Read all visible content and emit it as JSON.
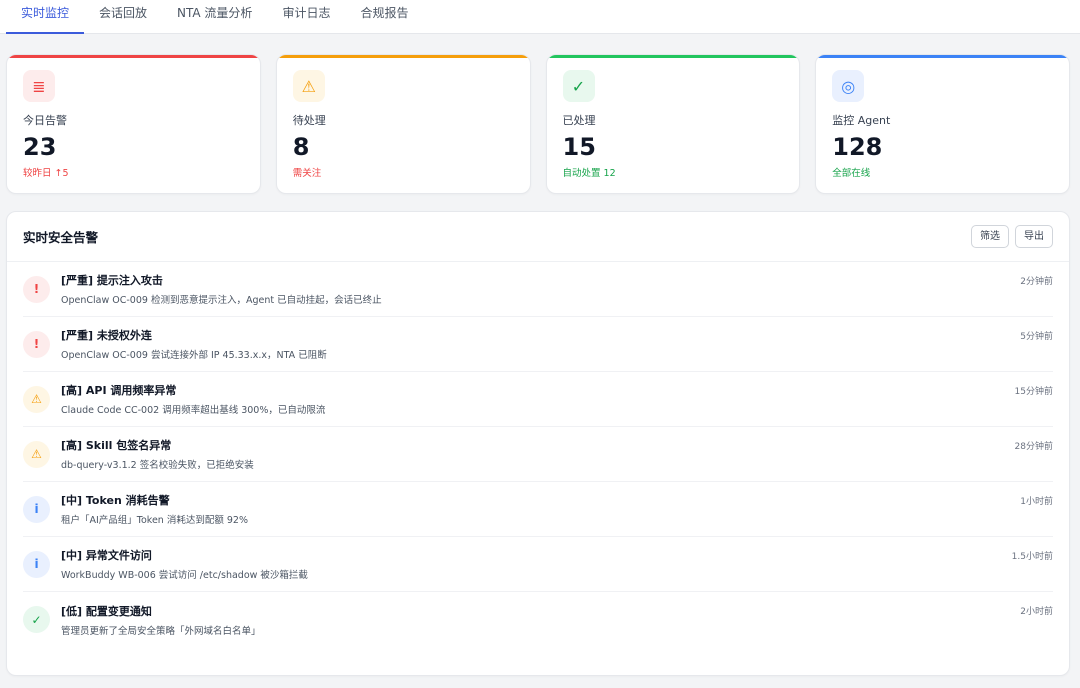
{
  "tabs": [
    {
      "label": "实时监控",
      "active": true
    },
    {
      "label": "会话回放"
    },
    {
      "label": "NTA 流量分析"
    },
    {
      "label": "审计日志"
    },
    {
      "label": "合规报告"
    }
  ],
  "cards": [
    {
      "label": "今日告警",
      "value": "23",
      "sub": "较昨日 ↑5",
      "icon": "list-icon",
      "glyph": "≣",
      "accent": "#ef4444",
      "icon_bg": "#fdecec",
      "icon_color": "#ef4444",
      "sub_color": "#ef4444"
    },
    {
      "label": "待处理",
      "value": "8",
      "sub": "需关注",
      "icon": "warning-icon",
      "glyph": "⚠",
      "accent": "#f59e0b",
      "icon_bg": "#fef6e4",
      "icon_color": "#f59e0b",
      "sub_color": "#ef4444"
    },
    {
      "label": "已处理",
      "value": "15",
      "sub": "自动处置 12",
      "icon": "check-icon",
      "glyph": "✓",
      "accent": "#22c55e",
      "icon_bg": "#e8f8ee",
      "icon_color": "#16a34a",
      "sub_color": "#16a34a"
    },
    {
      "label": "监控 Agent",
      "value": "128",
      "sub": "全部在线",
      "icon": "radar-icon",
      "glyph": "◎",
      "accent": "#3b82f6",
      "icon_bg": "#e9f0fe",
      "icon_color": "#3b82f6",
      "sub_color": "#16a34a"
    }
  ],
  "panel": {
    "title": "实时安全告警",
    "filter_label": "筛选",
    "export_label": "导出"
  },
  "alerts": [
    {
      "title": "[严重] 提示注入攻击",
      "desc": "OpenClaw OC-009 检测到恶意提示注入，Agent 已自动挂起，会话已终止",
      "time": "2分钟前",
      "severity": "critical",
      "glyph": "!",
      "icon": "alert-icon",
      "bg": "#fdecec",
      "color": "#ef4444"
    },
    {
      "title": "[严重] 未授权外连",
      "desc": "OpenClaw OC-009 尝试连接外部 IP 45.33.x.x，NTA 已阻断",
      "time": "5分钟前",
      "severity": "critical",
      "glyph": "!",
      "icon": "alert-icon",
      "bg": "#fdecec",
      "color": "#ef4444"
    },
    {
      "title": "[高] API 调用频率异常",
      "desc": "Claude Code CC-002 调用频率超出基线 300%，已自动限流",
      "time": "15分钟前",
      "severity": "high",
      "glyph": "⚠",
      "icon": "warning-icon",
      "bg": "#fef6e4",
      "color": "#f59e0b"
    },
    {
      "title": "[高] Skill 包签名异常",
      "desc": "db-query-v3.1.2 签名校验失败，已拒绝安装",
      "time": "28分钟前",
      "severity": "high",
      "glyph": "⚠",
      "icon": "warning-icon",
      "bg": "#fef6e4",
      "color": "#f59e0b"
    },
    {
      "title": "[中] Token 消耗告警",
      "desc": "租户「AI产品组」Token 消耗达到配额 92%",
      "time": "1小时前",
      "severity": "medium",
      "glyph": "i",
      "icon": "info-icon",
      "bg": "#e9f0fe",
      "color": "#3b82f6"
    },
    {
      "title": "[中] 异常文件访问",
      "desc": "WorkBuddy WB-006 尝试访问 /etc/shadow 被沙箱拦截",
      "time": "1.5小时前",
      "severity": "medium",
      "glyph": "i",
      "icon": "info-icon",
      "bg": "#e9f0fe",
      "color": "#3b82f6"
    },
    {
      "title": "[低] 配置变更通知",
      "desc": "管理员更新了全局安全策略「外网域名白名单」",
      "time": "2小时前",
      "severity": "low",
      "glyph": "✓",
      "icon": "check-icon",
      "bg": "#e8f8ee",
      "color": "#16a34a"
    }
  ]
}
